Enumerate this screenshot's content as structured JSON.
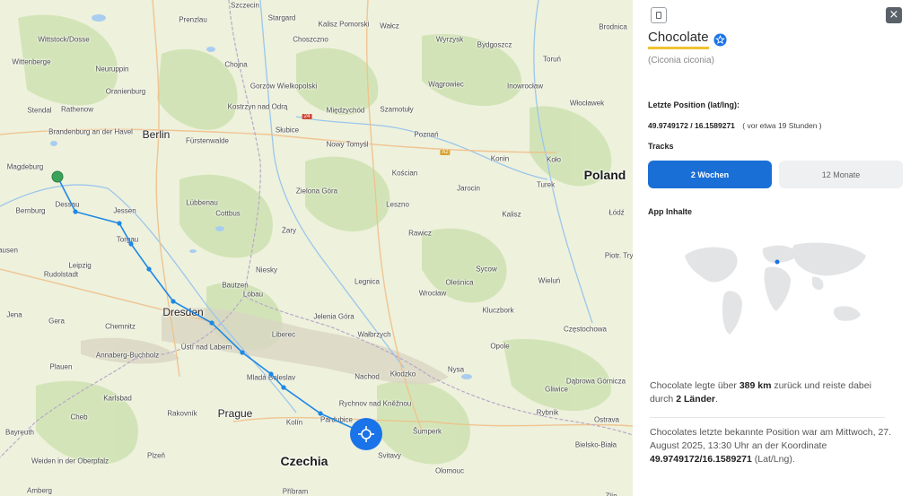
{
  "map": {
    "cities": [
      {
        "name": "Szczecin",
        "big": false
      },
      {
        "name": "Stargard",
        "big": false
      },
      {
        "name": "Kalisz Pomorski",
        "big": false
      },
      {
        "name": "Wałcz",
        "big": false
      },
      {
        "name": "Brodnica",
        "big": false
      },
      {
        "name": "Prenzlau",
        "big": false
      },
      {
        "name": "Choszczno",
        "big": false
      },
      {
        "name": "Wyrzysk",
        "big": false
      },
      {
        "name": "Bydgoszcz",
        "big": false
      },
      {
        "name": "Wittstock/Dosse",
        "big": false
      },
      {
        "name": "Wittenberge",
        "big": false
      },
      {
        "name": "Neuruppin",
        "big": false
      },
      {
        "name": "Chojna",
        "big": false
      },
      {
        "name": "Gorzów Wielkopolski",
        "big": false
      },
      {
        "name": "Wągrowiec",
        "big": false
      },
      {
        "name": "Toruń",
        "big": false
      },
      {
        "name": "Oranienburg",
        "big": false
      },
      {
        "name": "Inowrocław",
        "big": false
      },
      {
        "name": "Stendal",
        "big": false
      },
      {
        "name": "Rathenow",
        "big": false
      },
      {
        "name": "Kostrzyn nad Odrą",
        "big": false
      },
      {
        "name": "Szamotuły",
        "big": false
      },
      {
        "name": "Międzychód",
        "big": false
      },
      {
        "name": "Włocławek",
        "big": false
      },
      {
        "name": "Brandenburg an der Havel",
        "big": false
      },
      {
        "name": "Berlin",
        "big": true
      },
      {
        "name": "Słubice",
        "big": false
      },
      {
        "name": "Poznań",
        "big": false
      },
      {
        "name": "Fürstenwalde",
        "big": false
      },
      {
        "name": "Nowy Tomyśl",
        "big": false
      },
      {
        "name": "Konin",
        "big": false
      },
      {
        "name": "Koło",
        "big": false
      },
      {
        "name": "Magdeburg",
        "big": false
      },
      {
        "name": "Kościan",
        "big": false
      },
      {
        "name": "Turek",
        "big": false
      },
      {
        "name": "Zielona Góra",
        "big": false
      },
      {
        "name": "Jarocin",
        "big": false
      },
      {
        "name": "Dessau",
        "big": false
      },
      {
        "name": "Jessen",
        "big": false
      },
      {
        "name": "Lübbenau",
        "big": false
      },
      {
        "name": "Leszno",
        "big": false
      },
      {
        "name": "Bernburg",
        "big": false
      },
      {
        "name": "Cottbus",
        "big": false
      },
      {
        "name": "Kalisz",
        "big": false
      },
      {
        "name": "Łódź",
        "big": false
      },
      {
        "name": "Żary",
        "big": false
      },
      {
        "name": "Rawicz",
        "big": false
      },
      {
        "name": "Torgau",
        "big": false
      },
      {
        "name": "Piotr. Tryb.",
        "big": false
      },
      {
        "name": "Leipzig",
        "big": false
      },
      {
        "name": "Sycow",
        "big": false
      },
      {
        "name": "Niesky",
        "big": false
      },
      {
        "name": "Legnica",
        "big": false
      },
      {
        "name": "Oleśnica",
        "big": false
      },
      {
        "name": "Wieluń",
        "big": false
      },
      {
        "name": "Bautzen",
        "big": false
      },
      {
        "name": "Wrocław",
        "big": false
      },
      {
        "name": "Löbau",
        "big": false
      },
      {
        "name": "Dresden",
        "big": true
      },
      {
        "name": "Jelenia Góra",
        "big": false
      },
      {
        "name": "Kluczbork",
        "big": false
      },
      {
        "name": "Jena",
        "big": false
      },
      {
        "name": "Gera",
        "big": false
      },
      {
        "name": "Chemnitz",
        "big": false
      },
      {
        "name": "Częstochowa",
        "big": false
      },
      {
        "name": "Liberec",
        "big": false
      },
      {
        "name": "Wałbrzych",
        "big": false
      },
      {
        "name": "Ústí nad Labem",
        "big": false
      },
      {
        "name": "Annaberg-Buchholz",
        "big": false
      },
      {
        "name": "Opole",
        "big": false
      },
      {
        "name": "Plauen",
        "big": false
      },
      {
        "name": "Mladá Boleslav",
        "big": false
      },
      {
        "name": "Nachod",
        "big": false
      },
      {
        "name": "Kłodzko",
        "big": false
      },
      {
        "name": "Nysa",
        "big": false
      },
      {
        "name": "Dąbrowa Górnicza",
        "big": false
      },
      {
        "name": "Karlsbad",
        "big": false
      },
      {
        "name": "Rychnov nad Kněžnou",
        "big": false
      },
      {
        "name": "Gliwice",
        "big": false
      },
      {
        "name": "Rakovník",
        "big": false
      },
      {
        "name": "Prague",
        "big": true
      },
      {
        "name": "Pardubice",
        "big": false
      },
      {
        "name": "Rybnik",
        "big": false
      },
      {
        "name": "Cheb",
        "big": false
      },
      {
        "name": "Kolín",
        "big": false
      },
      {
        "name": "Šumperk",
        "big": false
      },
      {
        "name": "Ostrava",
        "big": false
      },
      {
        "name": "Bayreuth",
        "big": false
      },
      {
        "name": "Plzeň",
        "big": false
      },
      {
        "name": "Bielsko-Biała",
        "big": false
      },
      {
        "name": "Svitavy",
        "big": false
      },
      {
        "name": "Weiden in der Oberpfalz",
        "big": false
      },
      {
        "name": "Olomouc",
        "big": false
      },
      {
        "name": "Amberg",
        "big": false
      },
      {
        "name": "Příbram",
        "big": false
      },
      {
        "name": "Rudolstadt",
        "big": false
      },
      {
        "name": "Zlín",
        "big": false
      },
      {
        "name": "ausen",
        "big": false
      }
    ],
    "countries": [
      "Poland",
      "Czechia"
    ],
    "road_badges": [
      "24",
      "A2"
    ]
  },
  "panel": {
    "close_label": "×",
    "bird_name": "Chocolate",
    "species": "(Ciconia ciconia)",
    "last_position_label": "Letzte Position (lat/lng):",
    "coords": "49.9749172 / 16.1589271",
    "coords_ago": "( vor etwa 19 Stunden )",
    "tracks_label": "Tracks",
    "tracks": [
      "2 Wochen",
      "12 Monate"
    ],
    "active_track": "2 Wochen",
    "app_content_label": "App Inhalte",
    "summary1": {
      "p1": "Chocolate legte über ",
      "distance": "389 km",
      "p2": " zurück und reiste dabei durch ",
      "countries": "2 Länder",
      "p3": "."
    },
    "summary2": {
      "p1": "Chocolates letzte bekannte Position war am Mittwoch, 27. August 2025, 13:30 Uhr an der Koordinate ",
      "coords": "49.9749172/16.1589271",
      "p2": " (Lat/Lng)."
    }
  },
  "colors": {
    "accent": "#1a6fd6",
    "track": "#1e88e5",
    "highlight": "#f1c232"
  }
}
